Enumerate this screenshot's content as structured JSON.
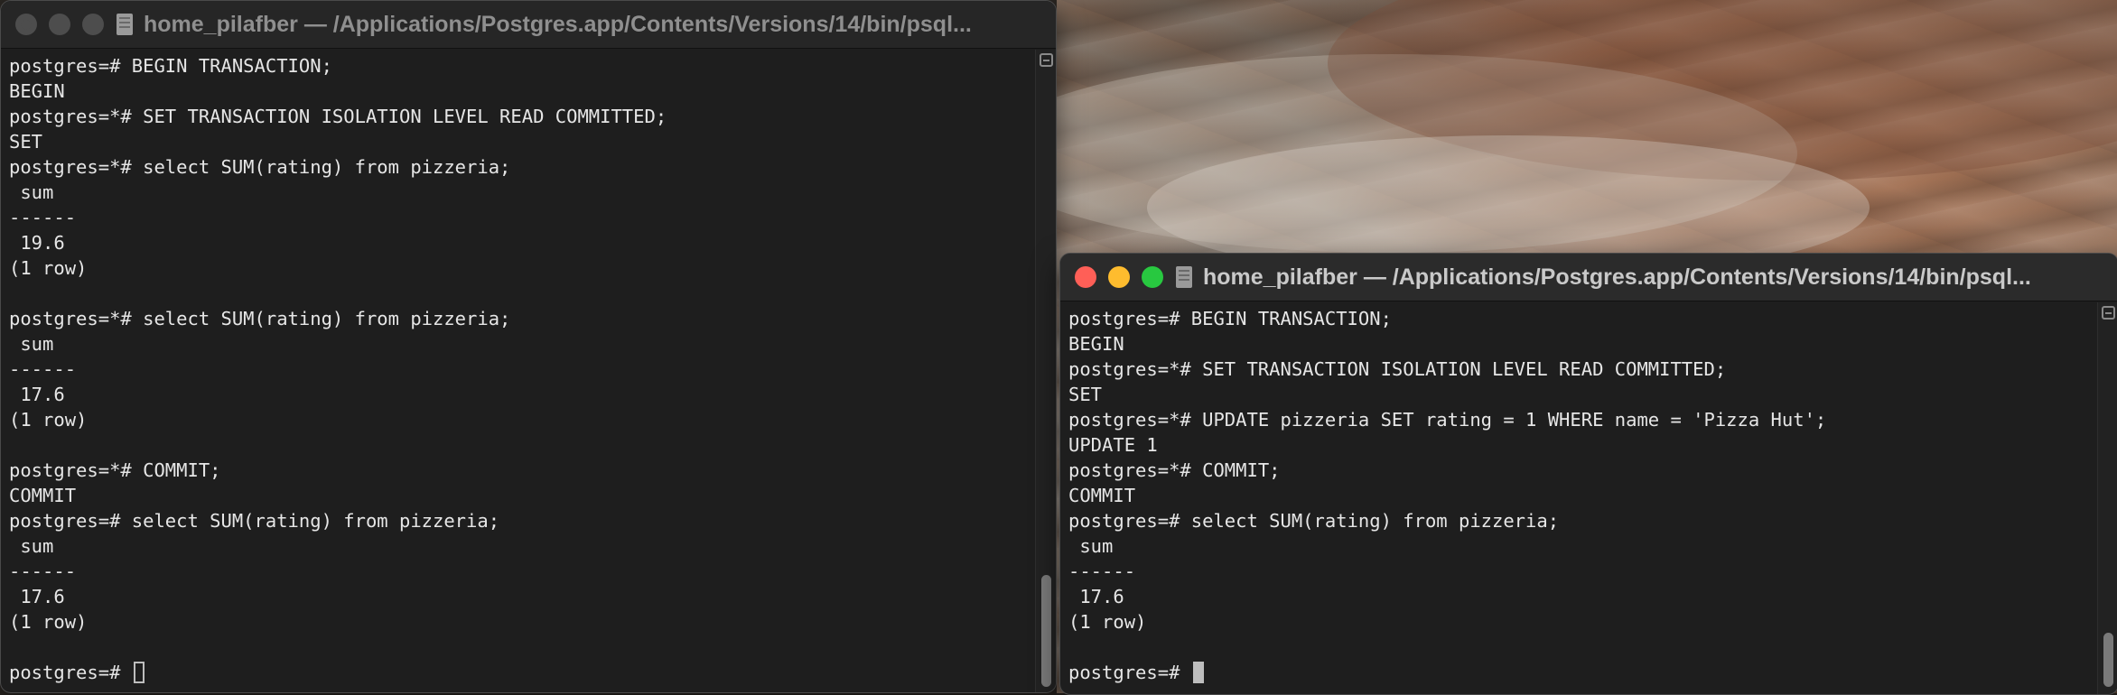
{
  "terminal_left": {
    "title": "home_pilafber — /Applications/Postgres.app/Contents/Versions/14/bin/psql...",
    "lines": [
      "postgres=# BEGIN TRANSACTION;",
      "BEGIN",
      "postgres=*# SET TRANSACTION ISOLATION LEVEL READ COMMITTED;",
      "SET",
      "postgres=*# select SUM(rating) from pizzeria;",
      " sum",
      "------",
      " 19.6",
      "(1 row)",
      "",
      "postgres=*# select SUM(rating) from pizzeria;",
      " sum",
      "------",
      " 17.6",
      "(1 row)",
      "",
      "postgres=*# COMMIT;",
      "COMMIT",
      "postgres=# select SUM(rating) from pizzeria;",
      " sum",
      "------",
      " 17.6",
      "(1 row)",
      ""
    ],
    "prompt": "postgres=# "
  },
  "terminal_right": {
    "title": "home_pilafber — /Applications/Postgres.app/Contents/Versions/14/bin/psql...",
    "lines": [
      "postgres=# BEGIN TRANSACTION;",
      "BEGIN",
      "postgres=*# SET TRANSACTION ISOLATION LEVEL READ COMMITTED;",
      "SET",
      "postgres=*# UPDATE pizzeria SET rating = 1 WHERE name = 'Pizza Hut';",
      "UPDATE 1",
      "postgres=*# COMMIT;",
      "COMMIT",
      "postgres=# select SUM(rating) from pizzeria;",
      " sum",
      "------",
      " 17.6",
      "(1 row)",
      ""
    ],
    "prompt": "postgres=# "
  },
  "icons": {
    "close": "close-icon",
    "minimize": "minimize-icon",
    "maximize": "maximize-icon",
    "document": "terminal-document-icon",
    "scroll_control": "scroll-view-toggle-icon"
  },
  "colors": {
    "close": "#ff5f57",
    "minimize": "#febc2e",
    "maximize": "#28c840",
    "terminal_bg": "#1e1e1e",
    "text": "#e6e6e6"
  }
}
